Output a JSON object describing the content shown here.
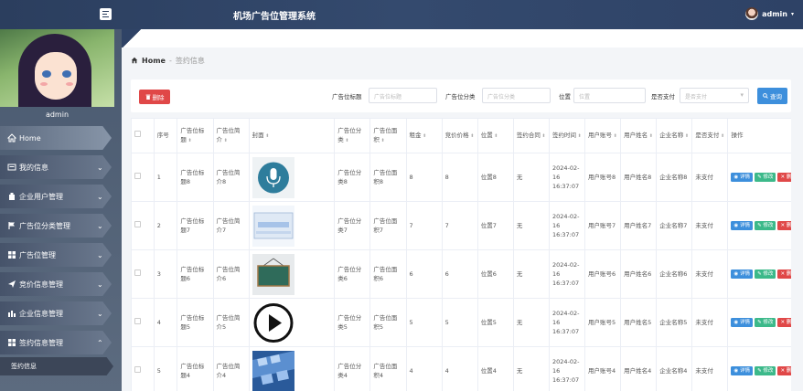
{
  "header": {
    "title": "机场广告位管理系统",
    "user": "admin"
  },
  "sidebar": {
    "admin_name": "admin",
    "items": [
      {
        "label": "Home",
        "icon": "home-icon",
        "has_caret": false
      },
      {
        "label": "我的信息",
        "icon": "id-card-icon",
        "has_caret": true
      },
      {
        "label": "企业用户管理",
        "icon": "user-icon",
        "has_caret": true
      },
      {
        "label": "广告位分类管理",
        "icon": "flag-icon",
        "has_caret": true
      },
      {
        "label": "广告位管理",
        "icon": "grid-icon",
        "has_caret": true
      },
      {
        "label": "竞价信息管理",
        "icon": "send-icon",
        "has_caret": true
      },
      {
        "label": "企业信息管理",
        "icon": "chart-icon",
        "has_caret": true
      },
      {
        "label": "签约信息管理",
        "icon": "grid-icon",
        "has_caret": true,
        "expanded": true
      }
    ],
    "sub_item": "签约信息"
  },
  "breadcrumb": {
    "home": "Home",
    "sep": "-",
    "current": "签约信息"
  },
  "filters": {
    "delete_label": "删除",
    "title_label": "广告位标题",
    "title_placeholder": "广告位标题",
    "category_label": "广告位分类",
    "category_placeholder": "广告位分类",
    "position_label": "位置",
    "position_placeholder": "位置",
    "paid_label": "是否支付",
    "paid_placeholder": "是否支付",
    "search_label": "查询"
  },
  "table": {
    "headers": [
      "序号",
      "广告位标题",
      "广告位简介",
      "封面",
      "广告位分类",
      "广告位面积",
      "租金",
      "竞价价格",
      "位置",
      "签约合同",
      "签约时间",
      "用户账号",
      "用户姓名",
      "企业名称",
      "是否支付",
      "操作"
    ],
    "actions": {
      "detail": "详情",
      "edit": "修改",
      "delete": "删除"
    },
    "rows": [
      {
        "idx": "1",
        "title": "广告位标题8",
        "intro": "广告位简介8",
        "cover": "microphone",
        "category": "广告位分类8",
        "area": "广告位面积8",
        "rent": "8",
        "bid": "8",
        "position": "位置8",
        "contract": "无",
        "time": "2024-02-16 16:37:07",
        "account": "用户账号8",
        "name": "用户姓名8",
        "company": "企业名称8",
        "paid": "未支付"
      },
      {
        "idx": "2",
        "title": "广告位标题7",
        "intro": "广告位简介7",
        "cover": "screen",
        "category": "广告位分类7",
        "area": "广告位面积7",
        "rent": "7",
        "bid": "7",
        "position": "位置7",
        "contract": "无",
        "time": "2024-02-16 16:37:07",
        "account": "用户账号7",
        "name": "用户姓名7",
        "company": "企业名称7",
        "paid": "未支付"
      },
      {
        "idx": "3",
        "title": "广告位标题6",
        "intro": "广告位简介6",
        "cover": "board",
        "category": "广告位分类6",
        "area": "广告位面积6",
        "rent": "6",
        "bid": "6",
        "position": "位置6",
        "contract": "无",
        "time": "2024-02-16 16:37:07",
        "account": "用户账号6",
        "name": "用户姓名6",
        "company": "企业名称6",
        "paid": "未支付"
      },
      {
        "idx": "4",
        "title": "广告位标题5",
        "intro": "广告位简介5",
        "cover": "play",
        "category": "广告位分类5",
        "area": "广告位面积5",
        "rent": "5",
        "bid": "5",
        "position": "位置5",
        "contract": "无",
        "time": "2024-02-16 16:37:07",
        "account": "用户账号5",
        "name": "用户姓名5",
        "company": "企业名称5",
        "paid": "未支付"
      },
      {
        "idx": "5",
        "title": "广告位标题4",
        "intro": "广告位简介4",
        "cover": "film",
        "category": "广告位分类4",
        "area": "广告位面积4",
        "rent": "4",
        "bid": "4",
        "position": "位置4",
        "contract": "无",
        "time": "2024-02-16 16:37:07",
        "account": "用户账号4",
        "name": "用户姓名4",
        "company": "企业名称4",
        "paid": "未支付"
      }
    ]
  }
}
